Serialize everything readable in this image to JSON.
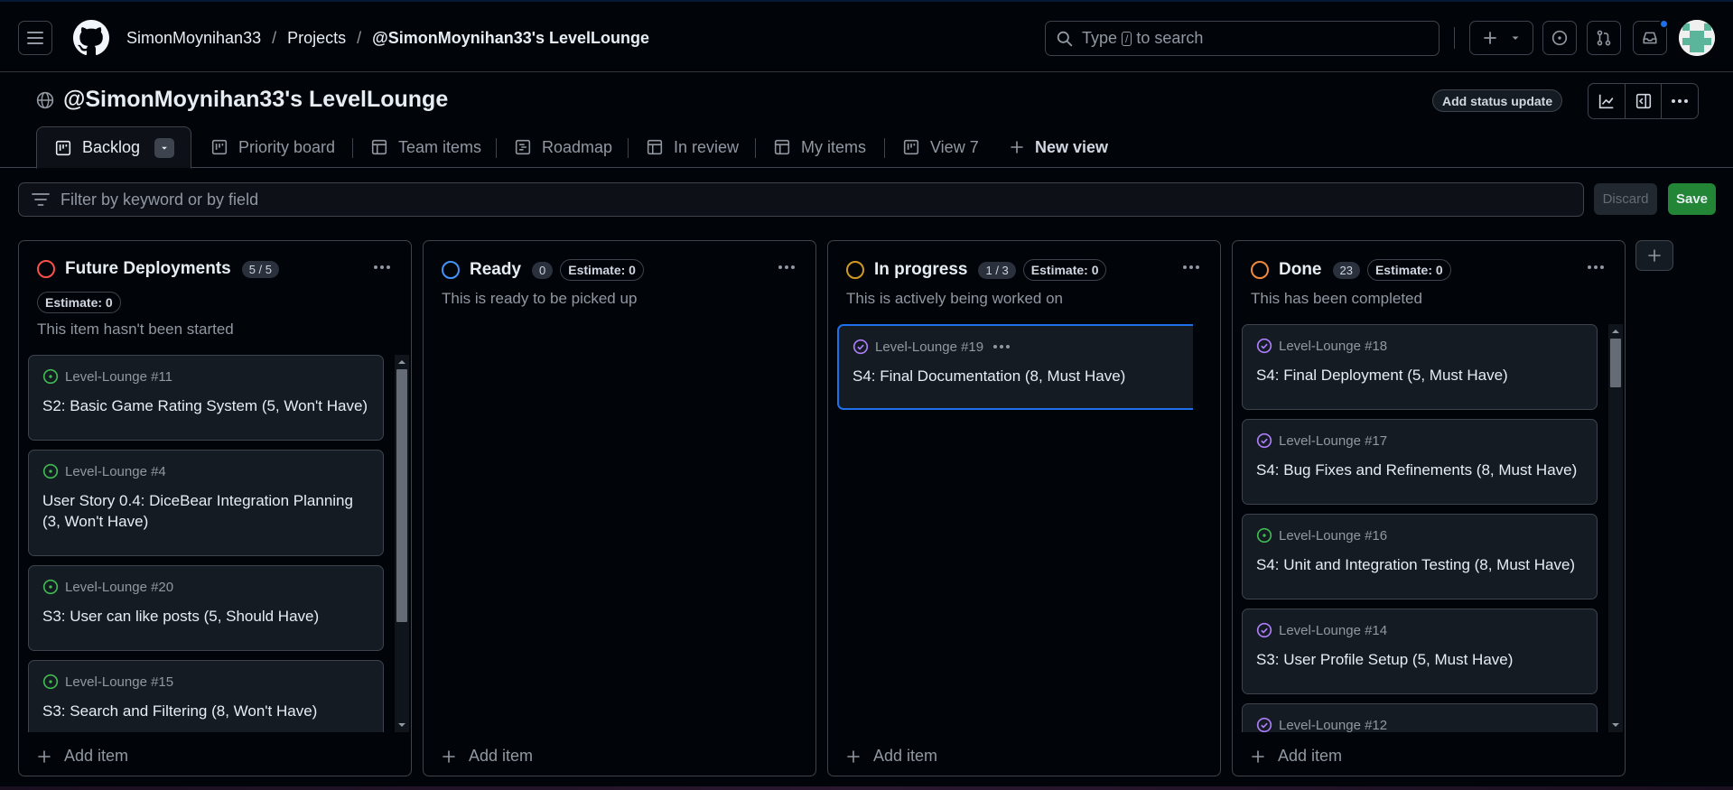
{
  "colors": {
    "accent_blue": "#1f6feb",
    "save_green": "#238636",
    "status_red": "#f85149",
    "status_blue": "#4493f8",
    "status_orange": "#d29922",
    "status_done": "#f0883e",
    "open_green": "#3fb950",
    "closed_purple": "#ab7df8"
  },
  "breadcrumb": {
    "owner": "SimonMoynihan33",
    "projects": "Projects",
    "project": "@SimonMoynihan33's LevelLounge",
    "sep": "/"
  },
  "search": {
    "before": "Type",
    "key": "/",
    "after": "to search"
  },
  "project": {
    "title": "@SimonMoynihan33's LevelLounge",
    "status_button": "Add status update"
  },
  "tabs": [
    {
      "label": "Backlog",
      "icon": "board-icon"
    },
    {
      "label": "Priority board",
      "icon": "board-icon"
    },
    {
      "label": "Team items",
      "icon": "table-icon"
    },
    {
      "label": "Roadmap",
      "icon": "roadmap-icon"
    },
    {
      "label": "In review",
      "icon": "table-icon"
    },
    {
      "label": "My items",
      "icon": "table-icon"
    },
    {
      "label": "View 7",
      "icon": "board-icon"
    },
    {
      "label": "New view",
      "icon": "plus-icon"
    }
  ],
  "filter": {
    "placeholder": "Filter by keyword or by field",
    "discard": "Discard",
    "save": "Save"
  },
  "columns": [
    {
      "name": "Future Deployments",
      "count": "5 / 5",
      "estimate": "Estimate: 0",
      "description": "This item hasn't been started",
      "add_item": "Add item",
      "cards": [
        {
          "ref": "Level-Lounge #11",
          "title": "S2: Basic Game Rating System (5, Won't Have)",
          "state": "open"
        },
        {
          "ref": "Level-Lounge #4",
          "title": "User Story 0.4: DiceBear Integration Planning (3, Won't Have)",
          "state": "open"
        },
        {
          "ref": "Level-Lounge #20",
          "title": "S3: User can like posts (5, Should Have)",
          "state": "open"
        },
        {
          "ref": "Level-Lounge #15",
          "title": "S3: Search and Filtering (8, Won't Have)",
          "state": "open"
        }
      ]
    },
    {
      "name": "Ready",
      "count": "0",
      "estimate": "Estimate: 0",
      "description": "This is ready to be picked up",
      "add_item": "Add item",
      "cards": []
    },
    {
      "name": "In progress",
      "count": "1 / 3",
      "estimate": "Estimate: 0",
      "description": "This is actively being worked on",
      "add_item": "Add item",
      "cards": [
        {
          "ref": "Level-Lounge #19",
          "title": "S4: Final Documentation (8, Must Have)",
          "state": "closed"
        }
      ]
    },
    {
      "name": "Done",
      "count": "23",
      "estimate": "Estimate: 0",
      "description": "This has been completed",
      "add_item": "Add item",
      "cards": [
        {
          "ref": "Level-Lounge #18",
          "title": "S4: Final Deployment (5, Must Have)",
          "state": "closed"
        },
        {
          "ref": "Level-Lounge #17",
          "title": "S4: Bug Fixes and Refinements (8, Must Have)",
          "state": "closed"
        },
        {
          "ref": "Level-Lounge #16",
          "title": "S4: Unit and Integration Testing (8, Must Have)",
          "state": "open"
        },
        {
          "ref": "Level-Lounge #14",
          "title": "S3: User Profile Setup (5, Must Have)",
          "state": "closed"
        },
        {
          "ref": "Level-Lounge #12",
          "title": "",
          "state": "closed"
        }
      ]
    }
  ]
}
